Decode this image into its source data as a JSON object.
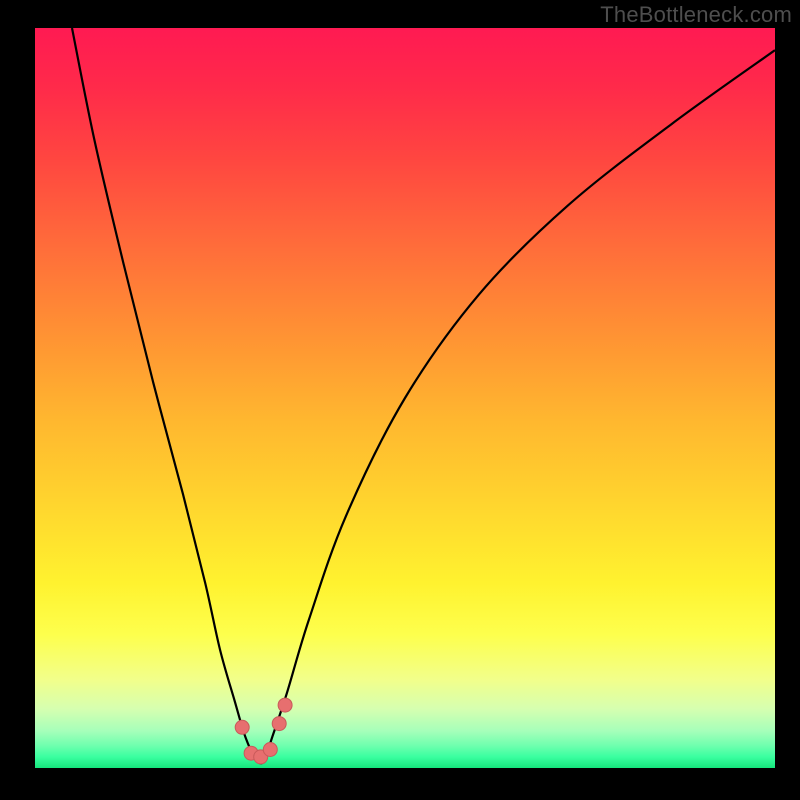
{
  "watermark": "TheBottleneck.com",
  "colors": {
    "frame": "#000000",
    "curve_stroke": "#000000",
    "marker_fill": "#e76f6f",
    "marker_stroke": "#c95a5a"
  },
  "chart_data": {
    "type": "line",
    "title": "",
    "xlabel": "",
    "ylabel": "",
    "xlim": [
      0,
      100
    ],
    "ylim": [
      0,
      100
    ],
    "grid": false,
    "series": [
      {
        "name": "bottleneck-curve",
        "x": [
          5,
          8,
          12,
          16,
          20,
          23,
          25,
          27,
          28.5,
          30,
          31,
          32,
          34,
          37,
          42,
          50,
          60,
          72,
          86,
          100
        ],
        "y": [
          100,
          85,
          68,
          52,
          37,
          25,
          16,
          9,
          4,
          1,
          1,
          4,
          10,
          20,
          34,
          50,
          64,
          76,
          87,
          97
        ]
      }
    ],
    "markers": [
      {
        "x": 28.0,
        "y": 5.5
      },
      {
        "x": 29.2,
        "y": 2.0
      },
      {
        "x": 30.5,
        "y": 1.5
      },
      {
        "x": 31.8,
        "y": 2.5
      },
      {
        "x": 33.0,
        "y": 6.0
      },
      {
        "x": 33.8,
        "y": 8.5
      }
    ]
  }
}
